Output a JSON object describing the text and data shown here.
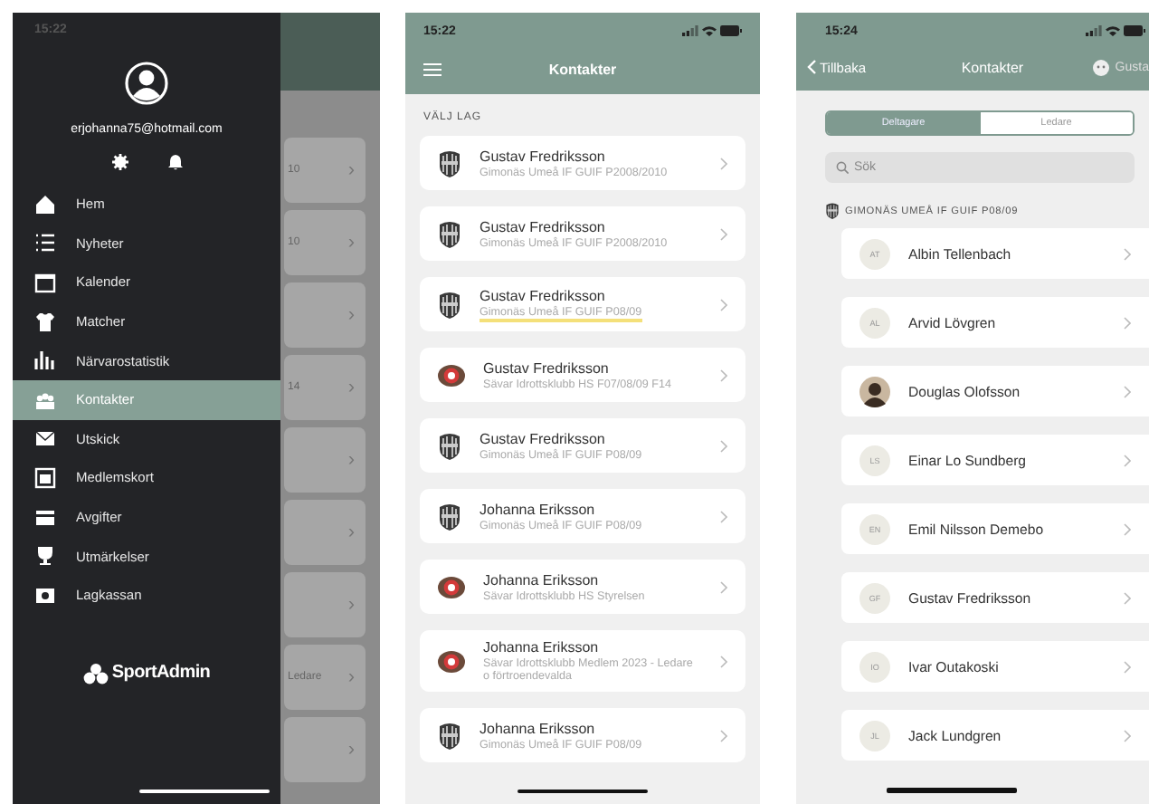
{
  "menu_screen": {
    "status_time": "15:22",
    "email": "erjohanna75@hotmail.com",
    "items": [
      {
        "label": "Hem",
        "selected": false
      },
      {
        "label": "Nyheter",
        "selected": false
      },
      {
        "label": "Kalender",
        "selected": false
      },
      {
        "label": "Matcher",
        "selected": false
      },
      {
        "label": "Närvarostatistik",
        "selected": false
      },
      {
        "label": "Kontakter",
        "selected": true
      },
      {
        "label": "Utskick",
        "selected": false
      },
      {
        "label": "Medlemskort",
        "selected": false
      },
      {
        "label": "Avgifter",
        "selected": false
      },
      {
        "label": "Utmärkelser",
        "selected": false
      },
      {
        "label": "Lagkassan",
        "selected": false
      }
    ],
    "logo": "SportAdmin",
    "background_cards": [
      {
        "peek": "10",
        "chevron": "›"
      },
      {
        "peek": "10",
        "chevron": "›"
      },
      {
        "chevron": "›"
      },
      {
        "peek": "14",
        "chevron": "›"
      },
      {
        "chevron": "›"
      },
      {
        "chevron": "›"
      },
      {
        "chevron": "›"
      },
      {
        "peek": "Ledare",
        "chevron": "›"
      },
      {
        "chevron": "›"
      }
    ]
  },
  "teams_screen": {
    "status_time": "15:22",
    "title": "Kontakter",
    "section": "VÄLJ LAG",
    "cards": [
      {
        "name": "Gustav Fredriksson",
        "team": "Gimonäs Umeå IF GUIF P2008/2010",
        "kind": "gimonas",
        "highlighted": false
      },
      {
        "name": "Gustav Fredriksson",
        "team": "Gimonäs Umeå IF GUIF P2008/2010",
        "kind": "gimonas",
        "highlighted": false
      },
      {
        "name": "Gustav Fredriksson",
        "team": "Gimonäs Umeå IF GUIF P08/09",
        "kind": "gimonas",
        "highlighted": true
      },
      {
        "name": "Gustav Fredriksson",
        "team": "Sävar Idrottsklubb HS F07/08/09 F14",
        "kind": "savar",
        "highlighted": false
      },
      {
        "name": "Gustav Fredriksson",
        "team": "Gimonäs Umeå IF GUIF P08/09",
        "kind": "gimonas",
        "highlighted": false
      },
      {
        "name": "Johanna Eriksson",
        "team": "Gimonäs Umeå IF GUIF P08/09",
        "kind": "gimonas",
        "highlighted": false
      },
      {
        "name": "Johanna Eriksson",
        "team": "Sävar Idrottsklubb HS Styrelsen",
        "kind": "savar",
        "highlighted": false
      },
      {
        "name": "Johanna Eriksson",
        "team": "Sävar Idrottsklubb Medlem 2023 - Ledare o förtroendevalda",
        "kind": "savar",
        "highlighted": false
      },
      {
        "name": "Johanna Eriksson",
        "team": "Gimonäs Umeå IF GUIF P08/09",
        "kind": "gimonas",
        "highlighted": false
      }
    ]
  },
  "contacts_screen": {
    "status_time": "15:24",
    "back": "Tillbaka",
    "title": "Kontakter",
    "user": "Gusta",
    "segments": [
      {
        "label": "Deltagare",
        "selected": true
      },
      {
        "label": "Ledare",
        "selected": false
      }
    ],
    "search": {
      "placeholder": "Sök"
    },
    "team": "GIMONÄS UMEÅ IF GUIF P08/09",
    "contacts": [
      {
        "name": "Albin Tellenbach",
        "kind": "initials",
        "initials": "AT"
      },
      {
        "name": "Arvid Lövgren",
        "kind": "initials",
        "initials": "AL"
      },
      {
        "name": "Douglas Olofsson",
        "kind": "photo"
      },
      {
        "name": "Einar Lo Sundberg",
        "kind": "initials",
        "initials": "LS"
      },
      {
        "name": "Emil Nilsson Demebo",
        "kind": "initials",
        "initials": "EN"
      },
      {
        "name": "Gustav Fredriksson",
        "kind": "initials",
        "initials": "GF"
      },
      {
        "name": "Ivar Outakoski",
        "kind": "initials",
        "initials": "IO"
      },
      {
        "name": "Jack Lundgren",
        "kind": "initials",
        "initials": "JL"
      }
    ]
  }
}
